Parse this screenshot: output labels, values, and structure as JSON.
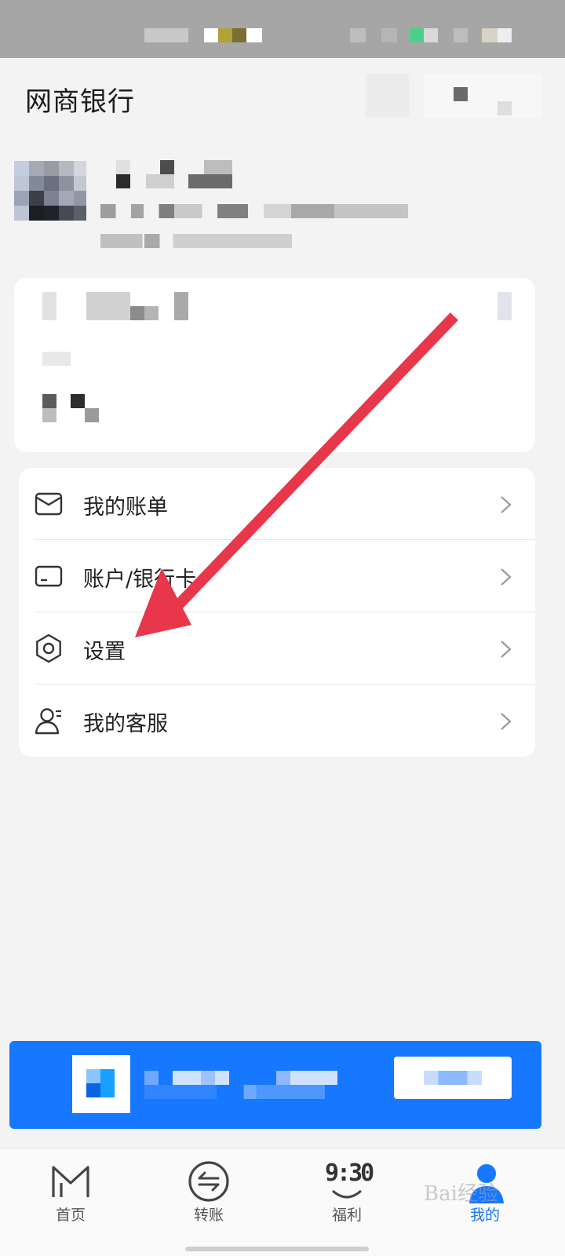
{
  "app": {
    "title": "网商银行"
  },
  "colors": {
    "accent": "#1677ff",
    "annotation_arrow": "#e8364a",
    "background": "#f3f3f3"
  },
  "menu": {
    "items": [
      {
        "label": "我的账单",
        "icon": "envelope-icon"
      },
      {
        "label": "账户/银行卡",
        "icon": "card-icon"
      },
      {
        "label": "设置",
        "icon": "gear-icon"
      },
      {
        "label": "我的客服",
        "icon": "customer-service-icon"
      }
    ]
  },
  "tabbar": {
    "tabs": [
      {
        "label": "首页",
        "icon": "home-m-icon",
        "active": false
      },
      {
        "label": "转账",
        "icon": "transfer-icon",
        "active": false
      },
      {
        "label": "福利",
        "icon": "smile-930-icon",
        "active": false
      },
      {
        "label": "我的",
        "icon": "person-icon",
        "active": true
      }
    ],
    "welfare_icon_text": "9:30"
  },
  "watermark": {
    "text": "Bai经验"
  }
}
